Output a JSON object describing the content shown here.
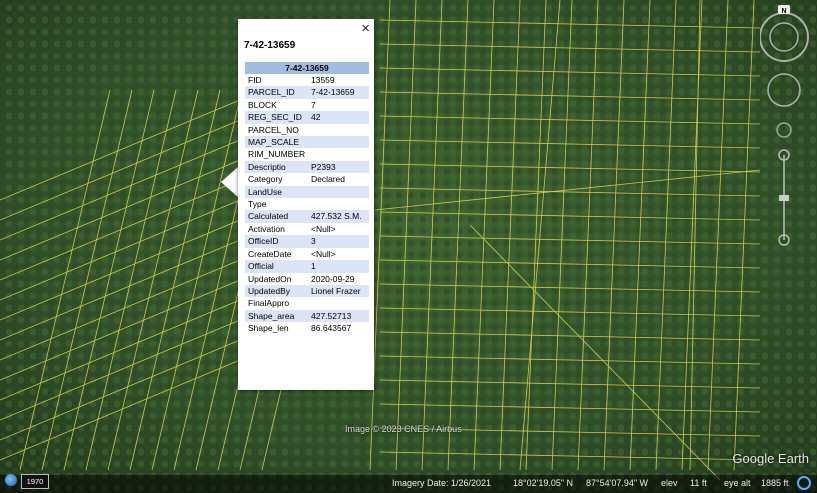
{
  "popup": {
    "close_glyph": "×",
    "title": "7-42-13659",
    "header": "7-42-13659",
    "rows": [
      [
        "FID",
        "13559"
      ],
      [
        "PARCEL_ID",
        "7-42-13659"
      ],
      [
        "BLOCK",
        "7"
      ],
      [
        "REG_SEC_ID",
        "42"
      ],
      [
        "PARCEL_NO",
        ""
      ],
      [
        "MAP_SCALE",
        ""
      ],
      [
        "RIM_NUMBER",
        ""
      ],
      [
        "Descriptio",
        "P2393"
      ],
      [
        "Category",
        "Declared"
      ],
      [
        "LandUse",
        ""
      ],
      [
        "Type",
        ""
      ],
      [
        "Calculated",
        "427.532 S.M."
      ],
      [
        "Activation",
        "<Null>"
      ],
      [
        "OfficeID",
        "3"
      ],
      [
        "CreateDate",
        "<Null>"
      ],
      [
        "Official",
        "1"
      ],
      [
        "UpdatedOn",
        "2020-09-29"
      ],
      [
        "UpdatedBy",
        "Lionel Frazer"
      ],
      [
        "FinalAppro",
        ""
      ],
      [
        "Shape_area",
        "427.52713"
      ],
      [
        "Shape_len",
        "86.643567"
      ]
    ]
  },
  "map": {
    "credit": "Image © 2023 CNES / Airbus",
    "logo": "Google Earth",
    "compass_label": "N",
    "parcel_line_color": "#e8e05a",
    "imagery_color": "#3a5a2a"
  },
  "status": {
    "year": "1970",
    "imagery_date": "Imagery Date: 1/26/2021",
    "lat": "18°02'19.05\" N",
    "lon": "87°54'07.94\" W",
    "elev_label": "elev",
    "elev": "11 ft",
    "eye_alt": "eye alt",
    "eye_alt_value": "1885 ft"
  }
}
